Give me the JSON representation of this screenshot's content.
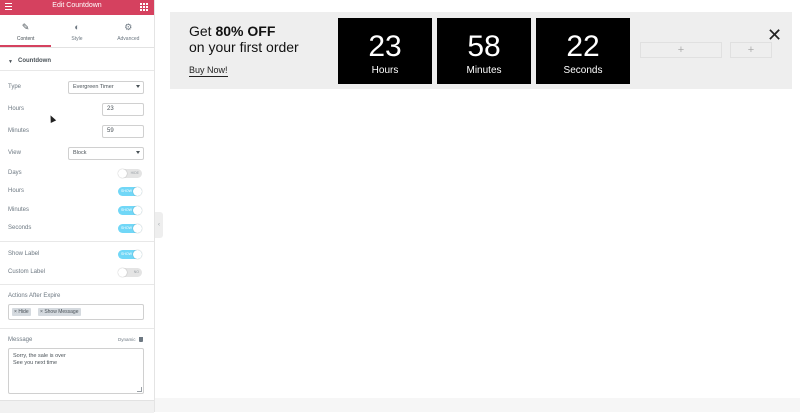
{
  "header": {
    "title": "Edit Countdown"
  },
  "tabs": [
    {
      "label": "Content",
      "icon": "pencil-icon",
      "active": true
    },
    {
      "label": "Style",
      "icon": "half-circle-icon",
      "active": false
    },
    {
      "label": "Advanced",
      "icon": "gear-icon",
      "active": false
    }
  ],
  "section": {
    "title": "Countdown"
  },
  "fields": {
    "type": {
      "label": "Type",
      "value": "Evergreen Timer"
    },
    "hours": {
      "label": "Hours",
      "value": "23"
    },
    "minutes": {
      "label": "Minutes",
      "value": "59"
    },
    "view": {
      "label": "View",
      "value": "Block"
    }
  },
  "toggles": {
    "days": {
      "label": "Days",
      "state": "HIDE",
      "on": false
    },
    "hours": {
      "label": "Hours",
      "state": "SHOW",
      "on": true
    },
    "minutes": {
      "label": "Minutes",
      "state": "SHOW",
      "on": true
    },
    "seconds": {
      "label": "Seconds",
      "state": "SHOW",
      "on": true
    },
    "show_label": {
      "label": "Show Label",
      "state": "SHOW",
      "on": true
    },
    "custom_label": {
      "label": "Custom Label",
      "state": "NO",
      "on": false
    }
  },
  "actions": {
    "label": "Actions After Expire",
    "chips": [
      "Hide",
      "Show Message"
    ]
  },
  "message": {
    "label": "Message",
    "dynamic": "Dynamic",
    "line1": "Sorry, the sale is over",
    "line2": "See you next time"
  },
  "promo": {
    "line1_prefix": "Get ",
    "line1_bold": "80% OFF",
    "line2": "on your first order",
    "cta": "Buy Now!"
  },
  "countdown": [
    {
      "value": "23",
      "unit": "Hours"
    },
    {
      "value": "58",
      "unit": "Minutes"
    },
    {
      "value": "22",
      "unit": "Seconds"
    }
  ],
  "empty_slot": "+",
  "colors": {
    "accent": "#d5415f",
    "toggle_on": "#71d7f7",
    "box": "#000000",
    "bar": "#eeeeee"
  }
}
